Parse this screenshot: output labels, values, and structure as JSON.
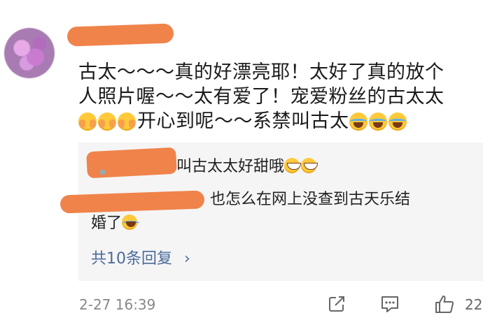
{
  "comment": {
    "line1": "古太～～～真的好漂亮耶！太好了真的放个",
    "line2": "人照片喔～～太有爱了！宠爱粉丝的古太太",
    "line3_text": "开心到呢～～系禁叫古太"
  },
  "replies": {
    "reply1_text": "叫古太太好甜哦",
    "reply2_text": "也怎么在网上没查到古天乐结",
    "reply2_cont": "婚了",
    "more_label": "共10条回复",
    "more_arrow": "›"
  },
  "footer": {
    "time": "2-27 16:39",
    "like_count": "22"
  },
  "colors": {
    "redaction": "#f0834a",
    "link": "#4a6b9a"
  }
}
